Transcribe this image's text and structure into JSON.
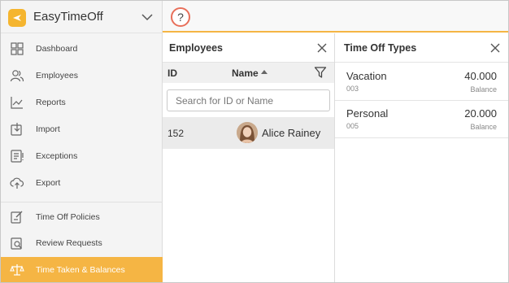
{
  "app": {
    "name": "EasyTimeOff"
  },
  "sidebar": {
    "items": [
      {
        "label": "Dashboard",
        "icon": "grid-icon"
      },
      {
        "label": "Employees",
        "icon": "people-icon"
      },
      {
        "label": "Reports",
        "icon": "chart-line-icon"
      },
      {
        "label": "Import",
        "icon": "import-icon"
      },
      {
        "label": "Exceptions",
        "icon": "exceptions-list-icon"
      },
      {
        "label": "Export",
        "icon": "cloud-upload-icon"
      },
      {
        "label": "Time Off Policies",
        "icon": "policy-icon"
      },
      {
        "label": "Review Requests",
        "icon": "review-icon"
      },
      {
        "label": "Time Taken & Balances",
        "icon": "balance-scale-icon",
        "active": true
      }
    ]
  },
  "topbar": {
    "help": "?"
  },
  "employees_panel": {
    "title": "Employees",
    "columns": {
      "id": "ID",
      "name": "Name"
    },
    "search_placeholder": "Search for ID or Name",
    "rows": [
      {
        "id": "152",
        "name": "Alice Rainey"
      }
    ]
  },
  "time_off_panel": {
    "title": "Time Off Types",
    "rows": [
      {
        "name": "Vacation",
        "code": "003",
        "value": "40.000",
        "caption": "Balance"
      },
      {
        "name": "Personal",
        "code": "005",
        "value": "20.000",
        "caption": "Balance"
      }
    ]
  },
  "colors": {
    "accent": "#f5b544",
    "active_bg": "#f5b544"
  }
}
